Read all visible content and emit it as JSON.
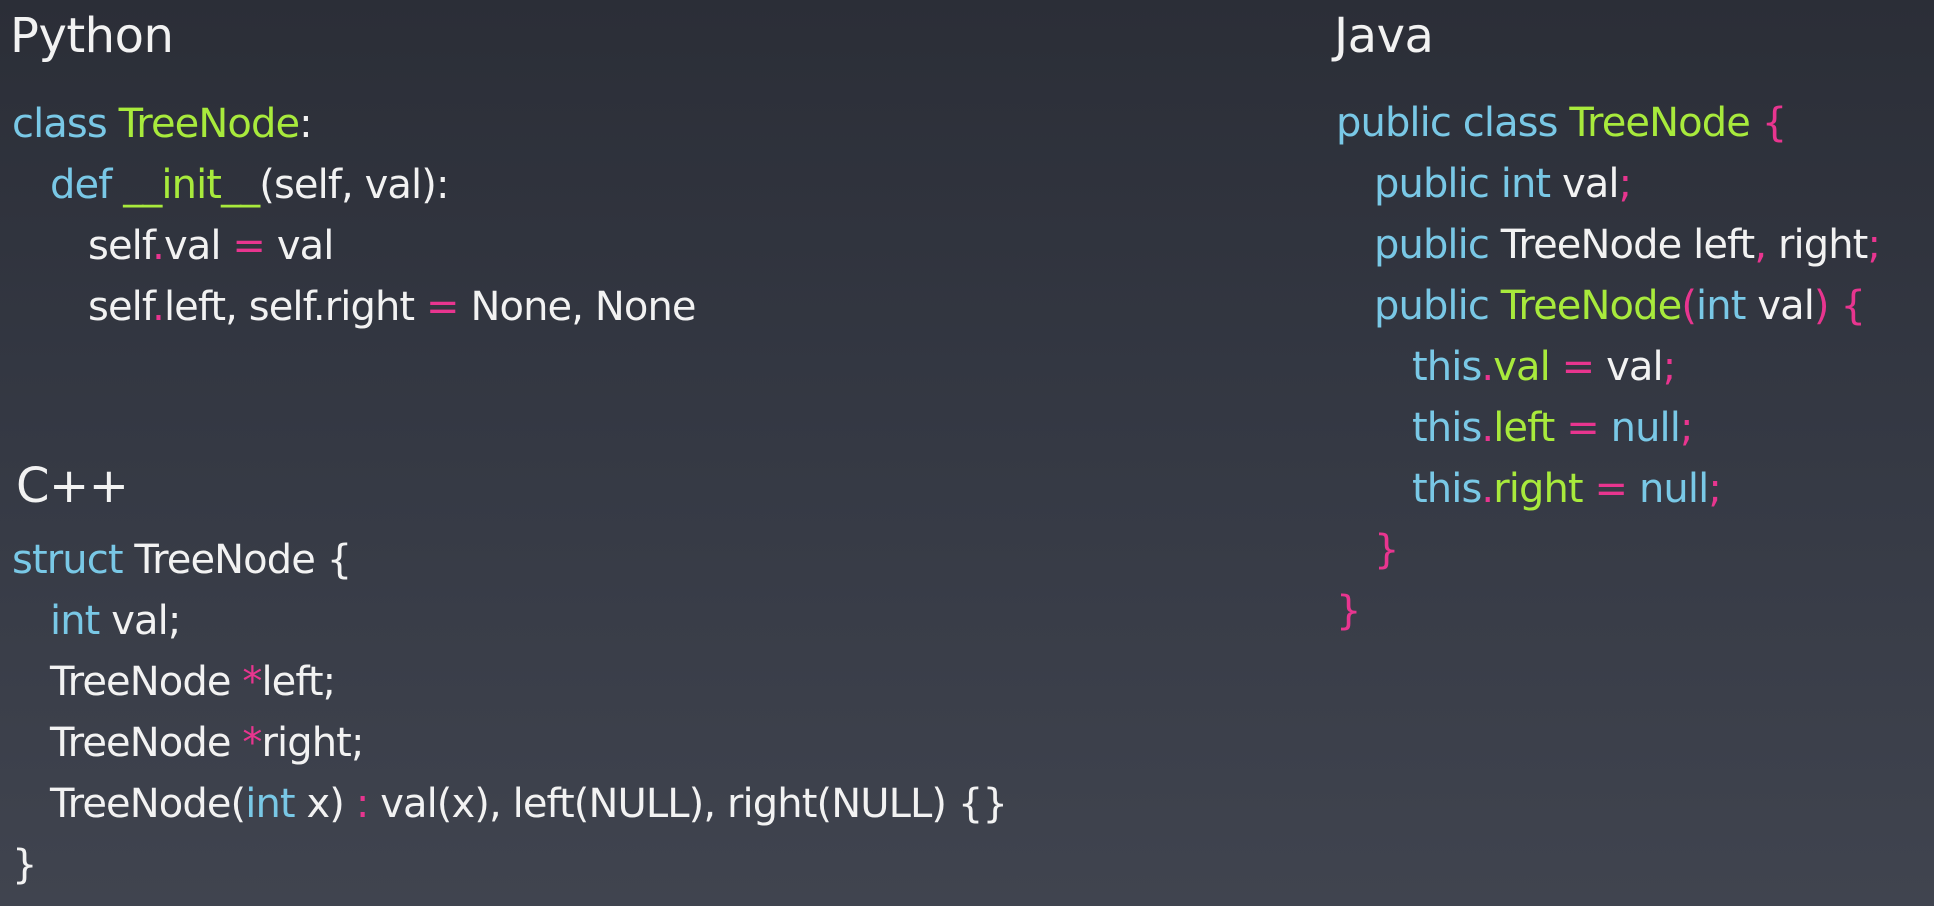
{
  "colors": {
    "keyword": "#79c8e6",
    "type_name": "#a8ea3c",
    "punctuation": "#e8358f",
    "plain": "#f2f2f2",
    "background_top": "#2b2e37",
    "background_bottom": "#40444f"
  },
  "sections": {
    "python": {
      "title": "Python",
      "lines": [
        {
          "indent": 0,
          "tokens": [
            {
              "text": "class ",
              "kind": "keyword"
            },
            {
              "text": "TreeNode",
              "kind": "type_name"
            },
            {
              "text": ":",
              "kind": "plain"
            }
          ]
        },
        {
          "indent": 1,
          "tokens": [
            {
              "text": "def ",
              "kind": "keyword"
            },
            {
              "text": "__init__",
              "kind": "type_name"
            },
            {
              "text": "(self, val):",
              "kind": "plain"
            }
          ]
        },
        {
          "indent": 2,
          "tokens": [
            {
              "text": "self",
              "kind": "plain"
            },
            {
              "text": ".",
              "kind": "punctuation"
            },
            {
              "text": "val ",
              "kind": "plain"
            },
            {
              "text": "=",
              "kind": "punctuation"
            },
            {
              "text": " val",
              "kind": "plain"
            }
          ]
        },
        {
          "indent": 2,
          "tokens": [
            {
              "text": "self",
              "kind": "plain"
            },
            {
              "text": ".",
              "kind": "punctuation"
            },
            {
              "text": "left, self.right ",
              "kind": "plain"
            },
            {
              "text": "=",
              "kind": "punctuation"
            },
            {
              "text": " None, None",
              "kind": "plain"
            }
          ]
        }
      ]
    },
    "cpp": {
      "title": "C++",
      "lines": [
        {
          "indent": 0,
          "tokens": [
            {
              "text": "struct ",
              "kind": "keyword"
            },
            {
              "text": "TreeNode {",
              "kind": "plain"
            }
          ]
        },
        {
          "indent": 1,
          "tokens": [
            {
              "text": "int",
              "kind": "keyword"
            },
            {
              "text": " val;",
              "kind": "plain"
            }
          ]
        },
        {
          "indent": 1,
          "tokens": [
            {
              "text": "TreeNode ",
              "kind": "plain"
            },
            {
              "text": "*",
              "kind": "punctuation"
            },
            {
              "text": "left;",
              "kind": "plain"
            }
          ]
        },
        {
          "indent": 1,
          "tokens": [
            {
              "text": "TreeNode ",
              "kind": "plain"
            },
            {
              "text": "*",
              "kind": "punctuation"
            },
            {
              "text": "right;",
              "kind": "plain"
            }
          ]
        },
        {
          "indent": 1,
          "tokens": [
            {
              "text": "TreeNode(",
              "kind": "plain"
            },
            {
              "text": "int",
              "kind": "keyword"
            },
            {
              "text": " x) ",
              "kind": "plain"
            },
            {
              "text": ":",
              "kind": "punctuation"
            },
            {
              "text": " val(x), left(NULL), right(NULL) {}",
              "kind": "plain"
            }
          ]
        },
        {
          "indent": 0,
          "tokens": [
            {
              "text": "}",
              "kind": "plain"
            }
          ]
        }
      ]
    },
    "java": {
      "title": "Java",
      "lines": [
        {
          "indent": 0,
          "tokens": [
            {
              "text": "public class ",
              "kind": "keyword"
            },
            {
              "text": "TreeNode",
              "kind": "type_name"
            },
            {
              "text": " {",
              "kind": "punctuation"
            }
          ]
        },
        {
          "indent": 1,
          "tokens": [
            {
              "text": "public int",
              "kind": "keyword"
            },
            {
              "text": " val",
              "kind": "plain"
            },
            {
              "text": ";",
              "kind": "punctuation"
            }
          ]
        },
        {
          "indent": 1,
          "tokens": [
            {
              "text": "public",
              "kind": "keyword"
            },
            {
              "text": " TreeNode left",
              "kind": "plain"
            },
            {
              "text": ",",
              "kind": "punctuation"
            },
            {
              "text": " right",
              "kind": "plain"
            },
            {
              "text": ";",
              "kind": "punctuation"
            }
          ]
        },
        {
          "indent": 1,
          "tokens": [
            {
              "text": "public ",
              "kind": "keyword"
            },
            {
              "text": "TreeNode",
              "kind": "type_name"
            },
            {
              "text": "(",
              "kind": "punctuation"
            },
            {
              "text": "int",
              "kind": "keyword"
            },
            {
              "text": " val",
              "kind": "plain"
            },
            {
              "text": ") {",
              "kind": "punctuation"
            }
          ]
        },
        {
          "indent": 2,
          "tokens": [
            {
              "text": "this",
              "kind": "keyword"
            },
            {
              "text": ".",
              "kind": "punctuation"
            },
            {
              "text": "val",
              "kind": "type_name"
            },
            {
              "text": " = ",
              "kind": "punctuation"
            },
            {
              "text": "val",
              "kind": "plain"
            },
            {
              "text": ";",
              "kind": "punctuation"
            }
          ]
        },
        {
          "indent": 2,
          "tokens": [
            {
              "text": "this",
              "kind": "keyword"
            },
            {
              "text": ".",
              "kind": "punctuation"
            },
            {
              "text": "left",
              "kind": "type_name"
            },
            {
              "text": " = ",
              "kind": "punctuation"
            },
            {
              "text": "null",
              "kind": "keyword"
            },
            {
              "text": ";",
              "kind": "punctuation"
            }
          ]
        },
        {
          "indent": 2,
          "tokens": [
            {
              "text": "this",
              "kind": "keyword"
            },
            {
              "text": ".",
              "kind": "punctuation"
            },
            {
              "text": "right",
              "kind": "type_name"
            },
            {
              "text": " = ",
              "kind": "punctuation"
            },
            {
              "text": "null",
              "kind": "keyword"
            },
            {
              "text": ";",
              "kind": "punctuation"
            }
          ]
        },
        {
          "indent": 1,
          "tokens": [
            {
              "text": "}",
              "kind": "punctuation"
            }
          ]
        },
        {
          "indent": 0,
          "tokens": [
            {
              "text": "}",
              "kind": "punctuation"
            }
          ]
        }
      ]
    }
  }
}
